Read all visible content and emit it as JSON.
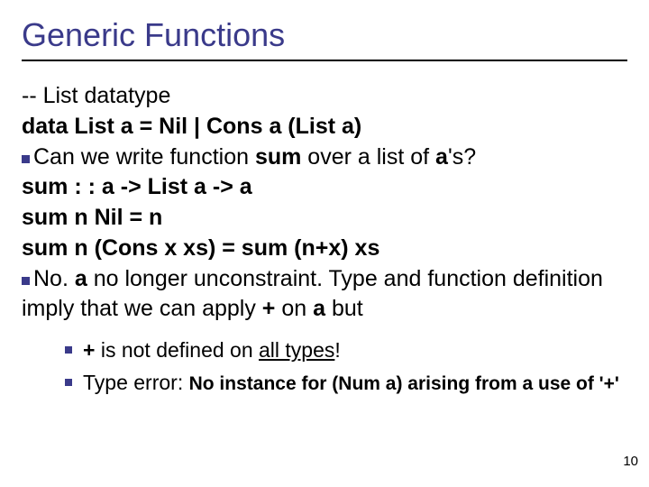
{
  "title": "Generic Functions",
  "lines": {
    "comment": "-- List datatype",
    "datadef": {
      "pre": "data List ",
      "a1": "a",
      "mid1": " = Nil | Cons ",
      "a2": "a",
      "mid2": " (List ",
      "a3": "a",
      "post": ")"
    },
    "q": {
      "pre": "Can we write function ",
      "sum": "sum",
      "mid": " over a list of ",
      "a": "a",
      "post": "'s?"
    },
    "sig": {
      "pre": "sum : : ",
      "a1": "a",
      "mid1": " -> List ",
      "a2": "a",
      "mid2": " -> ",
      "a3": "a"
    },
    "eqNil": "sum n Nil = n",
    "eqCons": {
      "pre": "sum n (Cons x xs) = sum (n",
      "plus": "+",
      "post": "x) xs"
    },
    "noLine": {
      "no": "No. ",
      "a": "a",
      "rest1": " no longer unconstraint. Type and function definition imply that we can apply ",
      "plus": "+",
      "rest2": " on ",
      "a2": "a",
      "rest3": " but"
    }
  },
  "sub": {
    "item1": {
      "plus": "+",
      "t1": " is not defined on ",
      "all": "all types",
      "t2": "!"
    },
    "item2": {
      "t1": "Type error: ",
      "err": "No instance for (Num a) arising from a use of '+'"
    }
  },
  "pageNumber": "10"
}
